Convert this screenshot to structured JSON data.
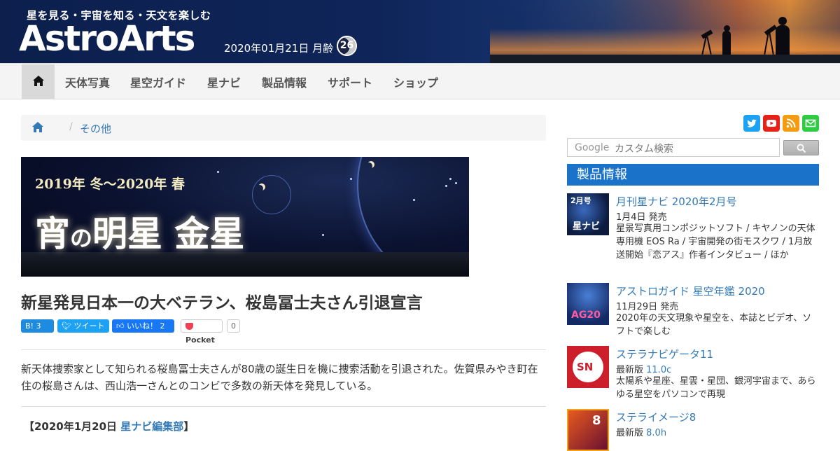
{
  "header": {
    "tagline": "星を見る・宇宙を知る・天文を楽しむ",
    "logo": "AstroArts",
    "date": "2020年01月21日 月齢",
    "moon_age": "26"
  },
  "nav": {
    "items": [
      "天体写真",
      "星空ガイド",
      "星ナビ",
      "製品情報",
      "サポート",
      "ショップ"
    ]
  },
  "breadcrumb": {
    "current": "その他"
  },
  "banner": {
    "subtitle": "2019年 冬～2020年 春",
    "title_a": "宵",
    "title_b": "の",
    "title_c": "明星 金星"
  },
  "article": {
    "title": "新星発見日本一の大ベテラン、桜島冨士夫さん引退宣言",
    "share": {
      "hatena": "B! 3",
      "tweet": "ツイート",
      "like": "いいね！ 2",
      "pocket": "Pocket",
      "pocket_count": "0"
    },
    "lead": "新天体捜索家として知られる桜島冨士夫さんが80歳の誕生日を機に捜索活動を引退された。佐賀県みやき町在住の桜島さんは、西山浩一さんとのコンビで多数の新天体を発見している。",
    "byline_prefix": "【2020年1月20日",
    "byline_author": "星ナビ編集部",
    "byline_suffix": "】"
  },
  "search": {
    "brand": "Google",
    "placeholder": "カスタム検索"
  },
  "sidebar": {
    "section_title": "製品情報",
    "products": [
      {
        "title": "月刊星ナビ 2020年2月号",
        "meta": "1月4日 発売",
        "version": "",
        "desc": "星景写真用コンポジットソフト / キヤノンの天体専用機 EOS Ra / 宇宙開発の街モスクワ / 1月放送開始『恋アス』作者インタビュー / ほか",
        "thumb_text": "2月号",
        "thumb_label": "星ナビ"
      },
      {
        "title": "アストロガイド 星空年鑑 2020",
        "meta": "11月29日 発売",
        "version": "",
        "desc": "2020年の天文現象や星空を、本誌とビデオ、ソフトで楽しむ",
        "thumb_text": "AG20"
      },
      {
        "title": "ステラナビゲータ11",
        "meta": "最新版",
        "version": "11.0c",
        "desc": "太陽系や星座、星雲・星団、銀河宇宙まで、あらゆる星空をパソコンで再現",
        "thumb_text": "SN"
      },
      {
        "title": "ステライメージ8",
        "meta": "最新版",
        "version": "8.0h",
        "desc": "",
        "thumb_text": "8"
      }
    ]
  },
  "colors": {
    "link": "#337ab7",
    "section": "#1a73c9",
    "nav_bg": "#f4f4f4"
  }
}
